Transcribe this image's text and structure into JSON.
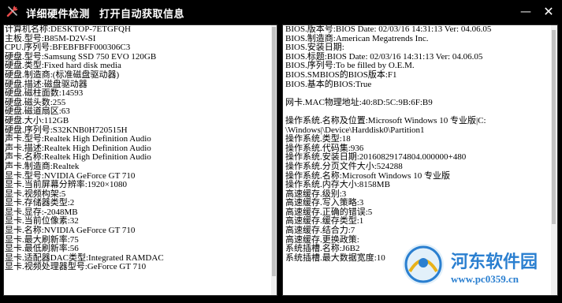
{
  "window": {
    "title": "详细硬件检测",
    "subtitle": "打开自动获取信息",
    "icon": "wrench-screwdriver-icon",
    "minimize_symbol": "—",
    "close_symbol": "✕"
  },
  "left_lines": [
    "计算机名称:DESKTOP-7ETGFQH",
    "主板.型号:B85M-D2V-SI",
    "CPU.序列号:BFEBFBFF000306C3",
    "硬盘.型号:Samsung SSD 750 EVO 120GB",
    "硬盘.类型:Fixed hard disk media",
    "硬盘.制造商:(标准磁盘驱动器)",
    "硬盘.描述:磁盘驱动器",
    "硬盘.磁柱面数:14593",
    "硬盘.磁头数:255",
    "硬盘.磁道扇区:63",
    "硬盘.大小:112GB",
    "硬盘.序列号:S32KNB0H720515H",
    "声卡.型号:Realtek High Definition Audio",
    "声卡.描述:Realtek High Definition Audio",
    "声卡.名称:Realtek High Definition Audio",
    "声卡.制造商:Realtek",
    "显卡.型号:NVIDIA GeForce GT 710",
    "显卡.当前屏幕分辨率:1920×1080",
    "显卡.视频构架:5",
    "显卡.存储器类型:2",
    "显卡.显存:-2048MB",
    "显卡.当前位像素:32",
    "显卡.名称:NVIDIA GeForce GT 710",
    "显卡.最大刷新率:75",
    "显卡.最低刷新率:56",
    "显卡.适配器DAC类型:Integrated RAMDAC",
    "显卡.视频处理器型号:GeForce GT 710"
  ],
  "right_lines": [
    "BIOS.版本号:BIOS Date: 02/03/16 14:31:13 Ver: 04.06.05",
    "BIOS.制造商:American Megatrends Inc.",
    "BIOS.安装日期:",
    "BIOS.标题:BIOS Date: 02/03/16 14:31:13 Ver: 04.06.05",
    "BIOS.序列号:To be filled by O.E.M.",
    "BIOS.SMBIOS的BIOS版本:F1",
    "BIOS.基本的BIOS:True",
    "",
    "网卡.MAC物理地址:40:8D:5C:9B:6F:B9",
    "",
    "操作系统.名称及位置:Microsoft Windows 10 专业版|C:",
    "\\Windows|\\Device\\Harddisk0\\Partition1",
    "操作系统.类型:18",
    "操作系统.代码集:936",
    "操作系统.安装日期:20160829174804.000000+480",
    "操作系统.分页文件大小:524288",
    "操作系统.名称:Microsoft Windows 10 专业版",
    "操作系统.内存大小:8158MB",
    "高速缓存.级别:3",
    "高速缓存.写入策略:3",
    "高速缓存.正确的错误:5",
    "高速缓存.缓存类型:1",
    "高速缓存.结合力:7",
    "高速缓存.更换政策:",
    "系统插槽.名称:J6B2",
    "系统插槽.最大数据宽度:10"
  ],
  "watermark": {
    "name": "河东软件园",
    "url": "www.pc0359.cn"
  }
}
